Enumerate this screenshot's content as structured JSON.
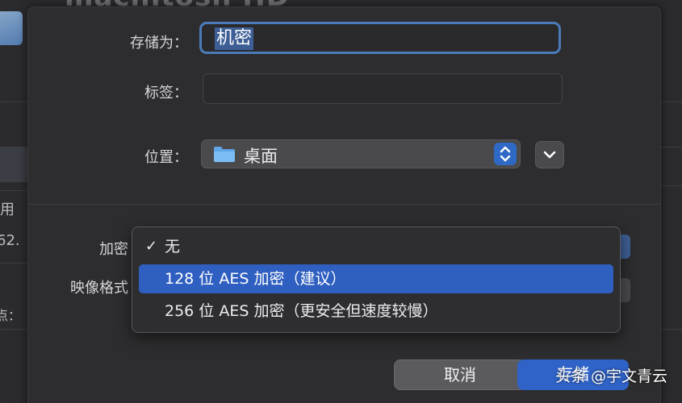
{
  "background": {
    "title_fragment": "macintosh HD",
    "side_label_1": "用",
    "side_label_2": "62.",
    "side_label_3": "点：",
    "icon": "disk-icon"
  },
  "dialog": {
    "save_as_label": "存储为：",
    "save_as_value": "机密",
    "tags_label": "标签：",
    "tags_value": "",
    "location_label": "位置：",
    "location_value": "桌面",
    "encryption_label": "加密",
    "image_format_label": "映像格式",
    "icons": {
      "folder": "folder-icon",
      "stepper": "up-down-chevron-icon",
      "expand": "chevron-down-icon"
    }
  },
  "encryption_menu": {
    "items": [
      {
        "label": "无",
        "checked": true,
        "selected": false
      },
      {
        "label": "128 位 AES 加密（建议）",
        "checked": false,
        "selected": true
      },
      {
        "label": "256 位 AES 加密（更安全但速度较慢）",
        "checked": false,
        "selected": false
      }
    ],
    "check_glyph": "✓"
  },
  "buttons": {
    "cancel_label": "取消",
    "save_label": "存储"
  },
  "watermark": "头条 @宇文青云",
  "colors": {
    "accent": "#2f63c8",
    "selection": "#3e5f96",
    "sheet_bg": "#2d2d2f"
  }
}
